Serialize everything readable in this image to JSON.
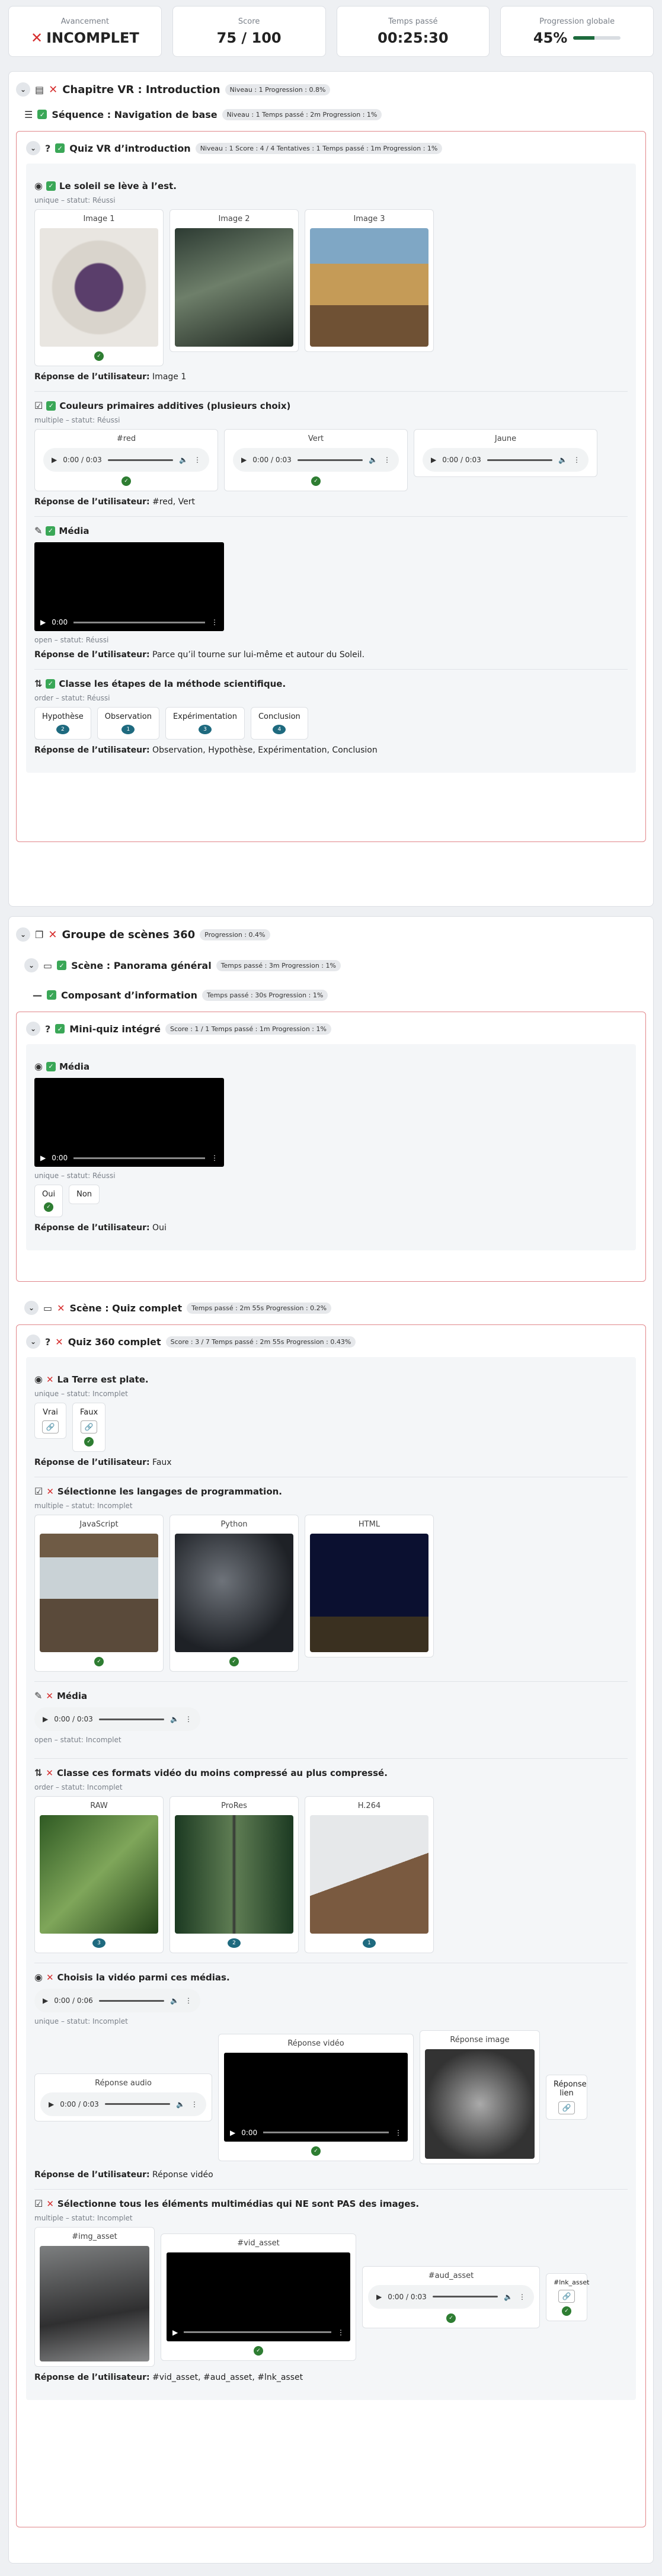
{
  "summary": {
    "status_label": "Avancement",
    "status_value": "INCOMPLET",
    "score_label": "Score",
    "score_value": "75 / 100",
    "time_label": "Temps passé",
    "time_value": "00:25:30",
    "progress_label": "Progression globale",
    "progress_value": "45%",
    "progress_fraction": 0.45
  },
  "ch1": {
    "title": "Chapitre VR : Introduction",
    "badge": "Niveau : 1  Progression : 0.8%",
    "seq_title": "Séquence : Navigation de base",
    "seq_badge": "Niveau : 1  Temps passé : 2m  Progression : 1%",
    "quiz_title": "Quiz VR d’introduction",
    "quiz_badge": "Niveau : 1  Score : 4 / 4  Tentatives : 1  Temps passé : 1m  Progression : 1%",
    "q1": {
      "title": "Le soleil se lève à l’est.",
      "meta": "unique – statut: Réussi",
      "o1": "Image 1",
      "o2": "Image 2",
      "o3": "Image 3",
      "answer_label": "Réponse de l’utilisateur:",
      "answer": "Image 1"
    },
    "q2": {
      "title": "Couleurs primaires additives (plusieurs choix)",
      "meta": "multiple – statut: Réussi",
      "o1": "#red",
      "o2": "Vert",
      "o3": "Jaune",
      "time": "0:00 / 0:03",
      "answer_label": "Réponse de l’utilisateur:",
      "answer": "#red, Vert"
    },
    "q3": {
      "title": "Média",
      "meta": "open – statut: Réussi",
      "time": "0:00",
      "answer_label": "Réponse de l’utilisateur:",
      "answer": "Parce qu’il tourne sur lui-même et autour du Soleil."
    },
    "q4": {
      "title": "Classe les étapes de la méthode scientifique.",
      "meta": "order – statut: Réussi",
      "o1": "Hypothèse",
      "o2": "Observation",
      "o3": "Expérimentation",
      "o4": "Conclusion",
      "answer_label": "Réponse de l’utilisateur:",
      "answer": "Observation, Hypothèse, Expérimentation, Conclusion"
    }
  },
  "ch2": {
    "title": "Groupe de scènes 360",
    "badge": "Progression : 0.4%",
    "scene1_title": "Scène : Panorama général",
    "scene1_badge": "Temps passé : 3m  Progression : 1%",
    "comp_title": "Composant d’information",
    "comp_badge": "Temps passé : 30s  Progression : 1%",
    "mini_title": "Mini-quiz intégré",
    "mini_badge": "Score : 1 / 1  Temps passé : 1m  Progression : 1%",
    "mq": {
      "title": "Média",
      "time": "0:00",
      "meta": "unique – statut: Réussi",
      "o1": "Oui",
      "o2": "Non",
      "answer_label": "Réponse de l’utilisateur:",
      "answer": "Oui"
    },
    "scene2_title": "Scène : Quiz complet",
    "scene2_badge": "Temps passé : 2m 55s  Progression : 0.2%",
    "quiz2_title": "Quiz 360 complet",
    "quiz2_badge": "Score : 3 / 7  Temps passé : 2m 55s  Progression : 0.43%",
    "a": {
      "title": "La Terre est plate.",
      "meta": "unique – statut: Incomplet",
      "o1": "Vrai",
      "o2": "Faux",
      "answer_label": "Réponse de l’utilisateur:",
      "answer": "Faux"
    },
    "b": {
      "title": "Sélectionne les langages de programmation.",
      "meta": "multiple – statut: Incomplet",
      "o1": "JavaScript",
      "o2": "Python",
      "o3": "HTML"
    },
    "c": {
      "title": "Média",
      "time": "0:00 / 0:03",
      "meta": "open – statut: Incomplet"
    },
    "d": {
      "title": "Classe ces formats vidéo du moins compressé au plus compressé.",
      "meta": "order – statut: Incomplet",
      "o1": "RAW",
      "o2": "ProRes",
      "o3": "H.264"
    },
    "e": {
      "title": "Choisis la vidéo parmi ces médias.",
      "time": "0:00 / 0:06",
      "meta": "unique – statut: Incomplet",
      "o1": "Réponse audio",
      "o1_time": "0:00 / 0:03",
      "o2": "Réponse vidéo",
      "o2_time": "0:00",
      "o3": "Réponse image",
      "o4": "Réponse lien",
      "answer_label": "Réponse de l’utilisateur:",
      "answer": "Réponse vidéo"
    },
    "f": {
      "title": "Sélectionne tous les éléments multimédias qui NE sont PAS des images.",
      "meta": "multiple – statut: Incomplet",
      "o1": "#img_asset",
      "o2": "#vid_asset",
      "o3": "#aud_asset",
      "o3_time": "0:00 / 0:03",
      "o4": "#lnk_asset",
      "answer_label": "Réponse de l’utilisateur:",
      "answer": "#vid_asset, #aud_asset, #lnk_asset"
    }
  }
}
